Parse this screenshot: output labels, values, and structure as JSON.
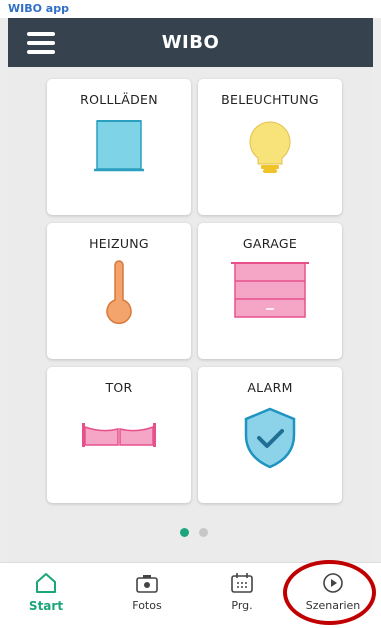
{
  "caption": "WIBO app",
  "header": {
    "title": "WIBO"
  },
  "tiles": [
    {
      "label": "ROLLLÄDEN"
    },
    {
      "label": "BELEUCHTUNG"
    },
    {
      "label": "HEIZUNG"
    },
    {
      "label": "GARAGE"
    },
    {
      "label": "TOR"
    },
    {
      "label": "ALARM"
    }
  ],
  "pager": {
    "pages": 2,
    "current": 1
  },
  "tabs": [
    {
      "label": "Start",
      "icon": "home-icon",
      "active": true
    },
    {
      "label": "Fotos",
      "icon": "camera-icon",
      "active": false
    },
    {
      "label": "Prg.",
      "icon": "calendar-icon",
      "active": false
    },
    {
      "label": "Szenarien",
      "icon": "play-icon",
      "active": false
    }
  ],
  "colors": {
    "header": "#36434f",
    "accent": "#1aa57a",
    "blind": "#7fd3e6",
    "bulb": "#f8e27a",
    "thermo": "#f2a46c",
    "pink": "#e8508c",
    "shield": "#8cd3ea",
    "highlight": "#c00000"
  }
}
